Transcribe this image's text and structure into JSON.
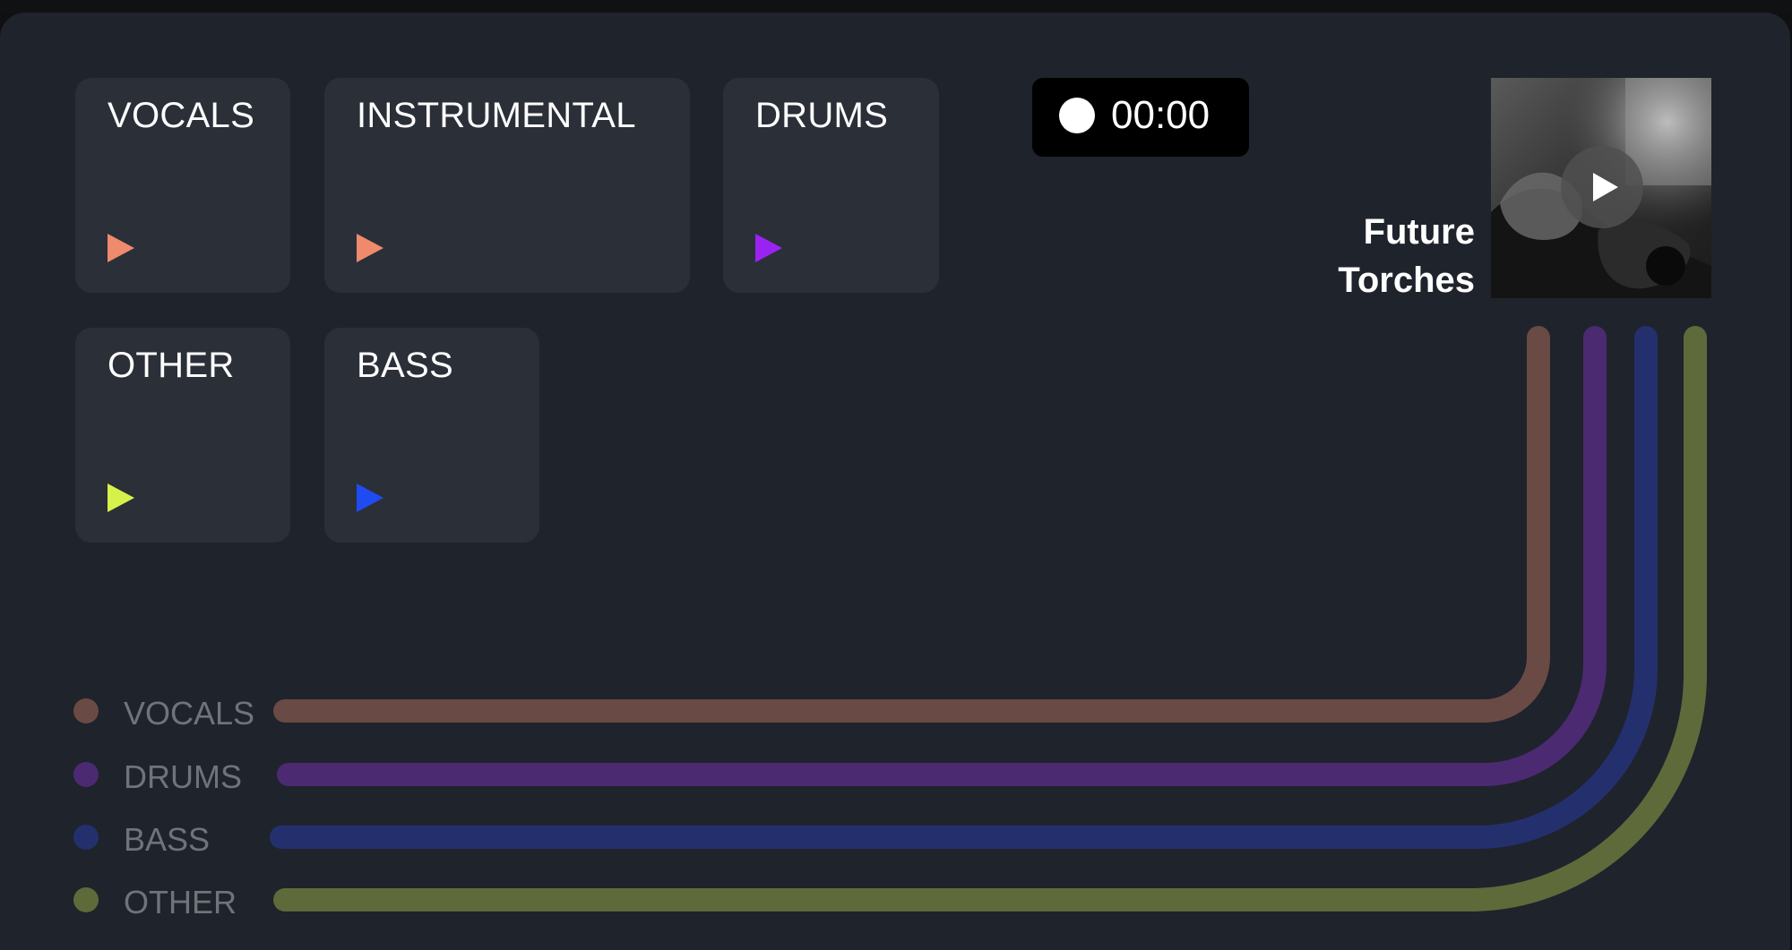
{
  "stems": [
    {
      "label": "VOCALS",
      "color": "#f08a6c"
    },
    {
      "label": "INSTRUMENTAL",
      "color": "#f08a6c"
    },
    {
      "label": "DRUMS",
      "color": "#9b23f2"
    },
    {
      "label": "OTHER",
      "color": "#d6f24a"
    },
    {
      "label": "BASS",
      "color": "#1f4bf2"
    }
  ],
  "timer": {
    "time": "00:00"
  },
  "song": {
    "title": "Future Torches"
  },
  "tracks": [
    {
      "label": "VOCALS",
      "color": "#6a4a44"
    },
    {
      "label": "DRUMS",
      "color": "#4b2a72"
    },
    {
      "label": "BASS",
      "color": "#24306e"
    },
    {
      "label": "OTHER",
      "color": "#5e6a3a"
    }
  ]
}
